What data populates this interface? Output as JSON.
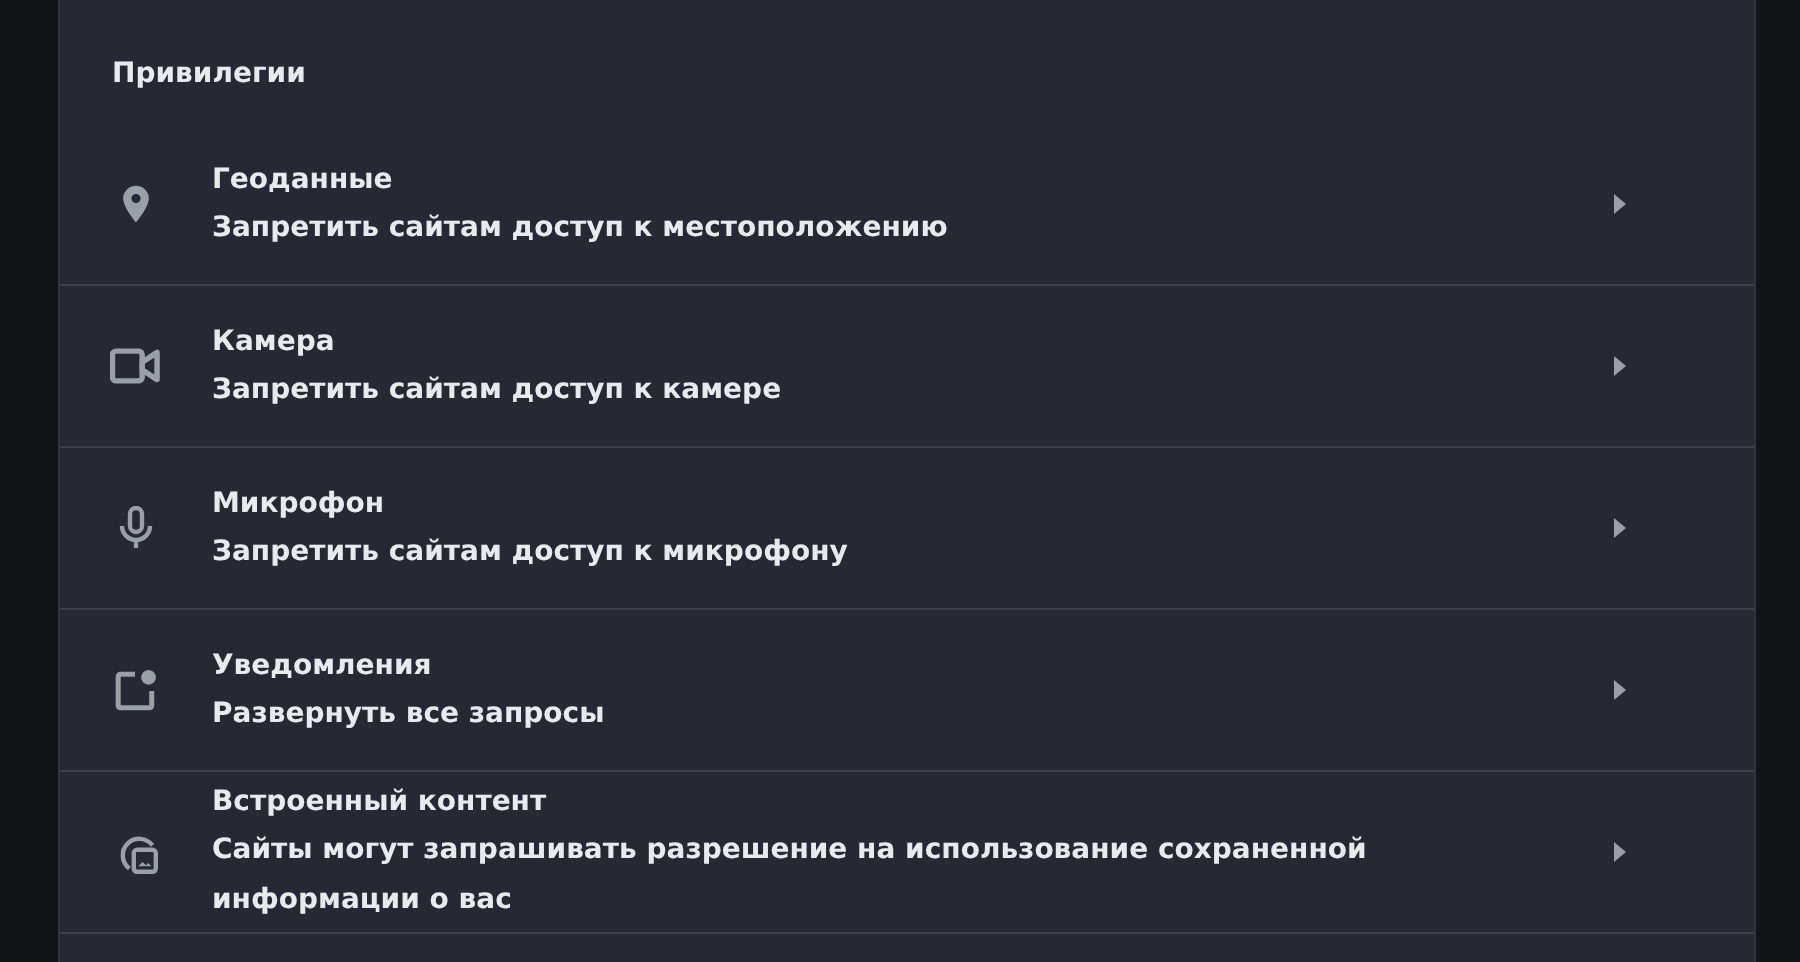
{
  "section": {
    "title": "Привилегии"
  },
  "items": [
    {
      "kind": "location",
      "title": "Геоданные",
      "subtitle": "Запретить сайтам доступ к местоположению"
    },
    {
      "kind": "camera",
      "title": "Камера",
      "subtitle": "Запретить сайтам доступ к камере"
    },
    {
      "kind": "microphone",
      "title": "Микрофон",
      "subtitle": "Запретить сайтам доступ к микрофону"
    },
    {
      "kind": "notification",
      "title": "Уведомления",
      "subtitle": "Развернуть все запросы"
    },
    {
      "kind": "embedded",
      "title": "Встроенный контент",
      "subtitle": "Сайты могут запрашивать разрешение на использование сохраненной информации о вас"
    }
  ]
}
